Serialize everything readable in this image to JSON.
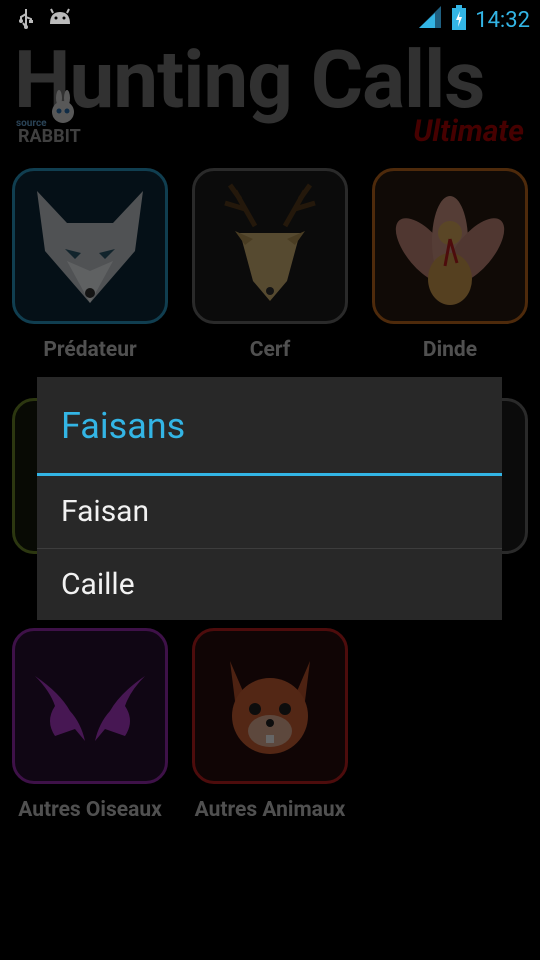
{
  "status_bar": {
    "time": "14:32",
    "icons": [
      "usb-icon",
      "android-icon",
      "signal-icon",
      "battery-charging-icon"
    ]
  },
  "header": {
    "title": "Hunting Calls",
    "subtitle": "Ultimate",
    "logo_small": "source",
    "logo_big": "RABBIT"
  },
  "grid": {
    "items": [
      {
        "label": "Prédateur",
        "icon": "fox-icon",
        "color": "#2a9bc7"
      },
      {
        "label": "Cerf",
        "icon": "deer-icon",
        "color": "#6a6a6a"
      },
      {
        "label": "Dinde",
        "icon": "turkey-icon",
        "color": "#c26a1c"
      },
      {
        "label": "Autres Oiseaux",
        "icon": "doves-icon",
        "color": "#9b2bb3"
      },
      {
        "label": "Autres Animaux",
        "icon": "squirrel-icon",
        "color": "#c02020"
      }
    ]
  },
  "dialog": {
    "title": "Faisans",
    "options": [
      "Faisan",
      "Caille"
    ]
  },
  "colors": {
    "accent": "#33b5e5",
    "dialog_bg": "#282828",
    "subtitle": "#b00000"
  }
}
